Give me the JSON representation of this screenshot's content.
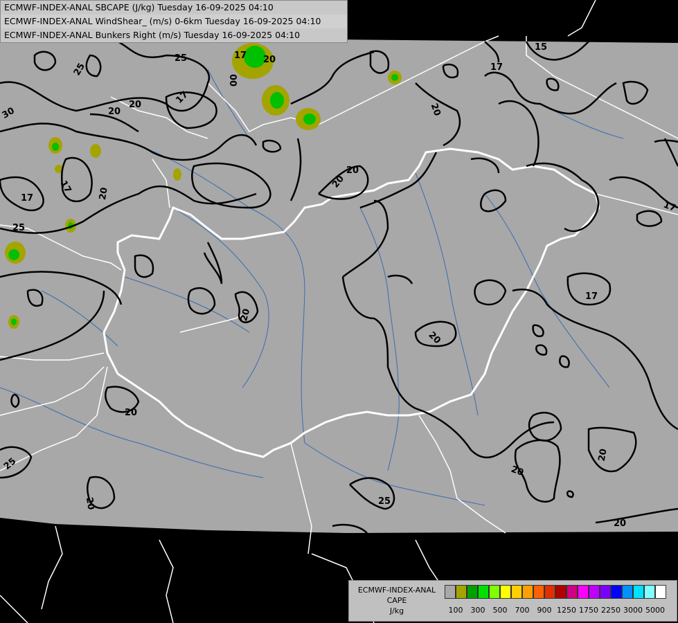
{
  "header": {
    "line1": "ECMWF-INDEX-ANAL SBCAPE (J/kg) Tuesday 16-09-2025 04:10",
    "line2": "ECMWF-INDEX-ANAL WindShear_ (m/s) 0-6km Tuesday 16-09-2025 04:10",
    "line3": "ECMWF-INDEX-ANAL Bunkers Right (m/s) Tuesday 16-09-2025 04:10"
  },
  "legend": {
    "title1": "ECMWF-INDEX-ANAL",
    "title2": "CAPE",
    "title3": "J/kg",
    "tick_labels": [
      "100",
      "300",
      "500",
      "700",
      "900",
      "1250",
      "1750",
      "2250",
      "3000",
      "5000"
    ],
    "colors": [
      "#a8a8a8",
      "#a4a400",
      "#00a000",
      "#00e000",
      "#80ff00",
      "#ffff00",
      "#ffd000",
      "#ffa000",
      "#ff6000",
      "#e03000",
      "#b00000",
      "#d00080",
      "#ff00ff",
      "#c000ff",
      "#7800ff",
      "#0000ff",
      "#0090ff",
      "#00e0ff",
      "#80ffff",
      "#ffffff"
    ]
  },
  "contour_labels": [
    "17",
    "25",
    "25",
    "00",
    "30",
    "20",
    "17",
    "15",
    "17",
    "20",
    "20",
    "17",
    "25",
    "20",
    "17",
    "20",
    "20",
    "20",
    "20",
    "20",
    "25",
    "20",
    "20",
    "20",
    "20",
    "20",
    "25",
    "17",
    "17"
  ],
  "colors": {
    "map_fill": "#a8a8a8",
    "background": "#000000",
    "contour": "#000000",
    "border": "#ffffff",
    "river": "#3a6bb0"
  }
}
